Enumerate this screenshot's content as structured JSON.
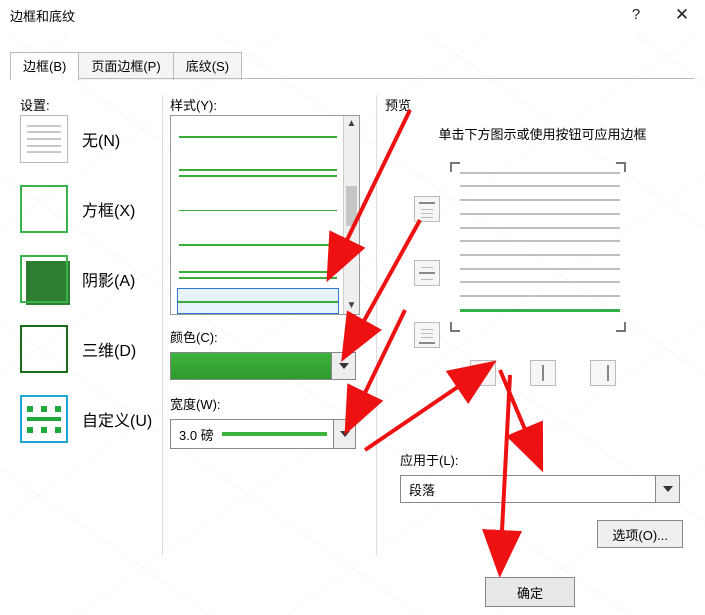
{
  "window": {
    "title": "边框和底纹"
  },
  "tabs": {
    "borders": "边框(B)",
    "page_borders": "页面边框(P)",
    "shading": "底纹(S)"
  },
  "settings": {
    "label": "设置:",
    "none": "无(N)",
    "box": "方框(X)",
    "shadow": "阴影(A)",
    "three_d": "三维(D)",
    "custom": "自定义(U)"
  },
  "style": {
    "label": "样式(Y):"
  },
  "color": {
    "label": "颜色(C):",
    "value": "#39AE39"
  },
  "width": {
    "label": "宽度(W):",
    "value": "3.0 磅"
  },
  "preview": {
    "label": "预览",
    "hint": "单击下方图示或使用按钮可应用边框"
  },
  "apply_to": {
    "label": "应用于(L):",
    "value": "段落"
  },
  "buttons": {
    "options": "选项(O)...",
    "ok": "确定"
  }
}
